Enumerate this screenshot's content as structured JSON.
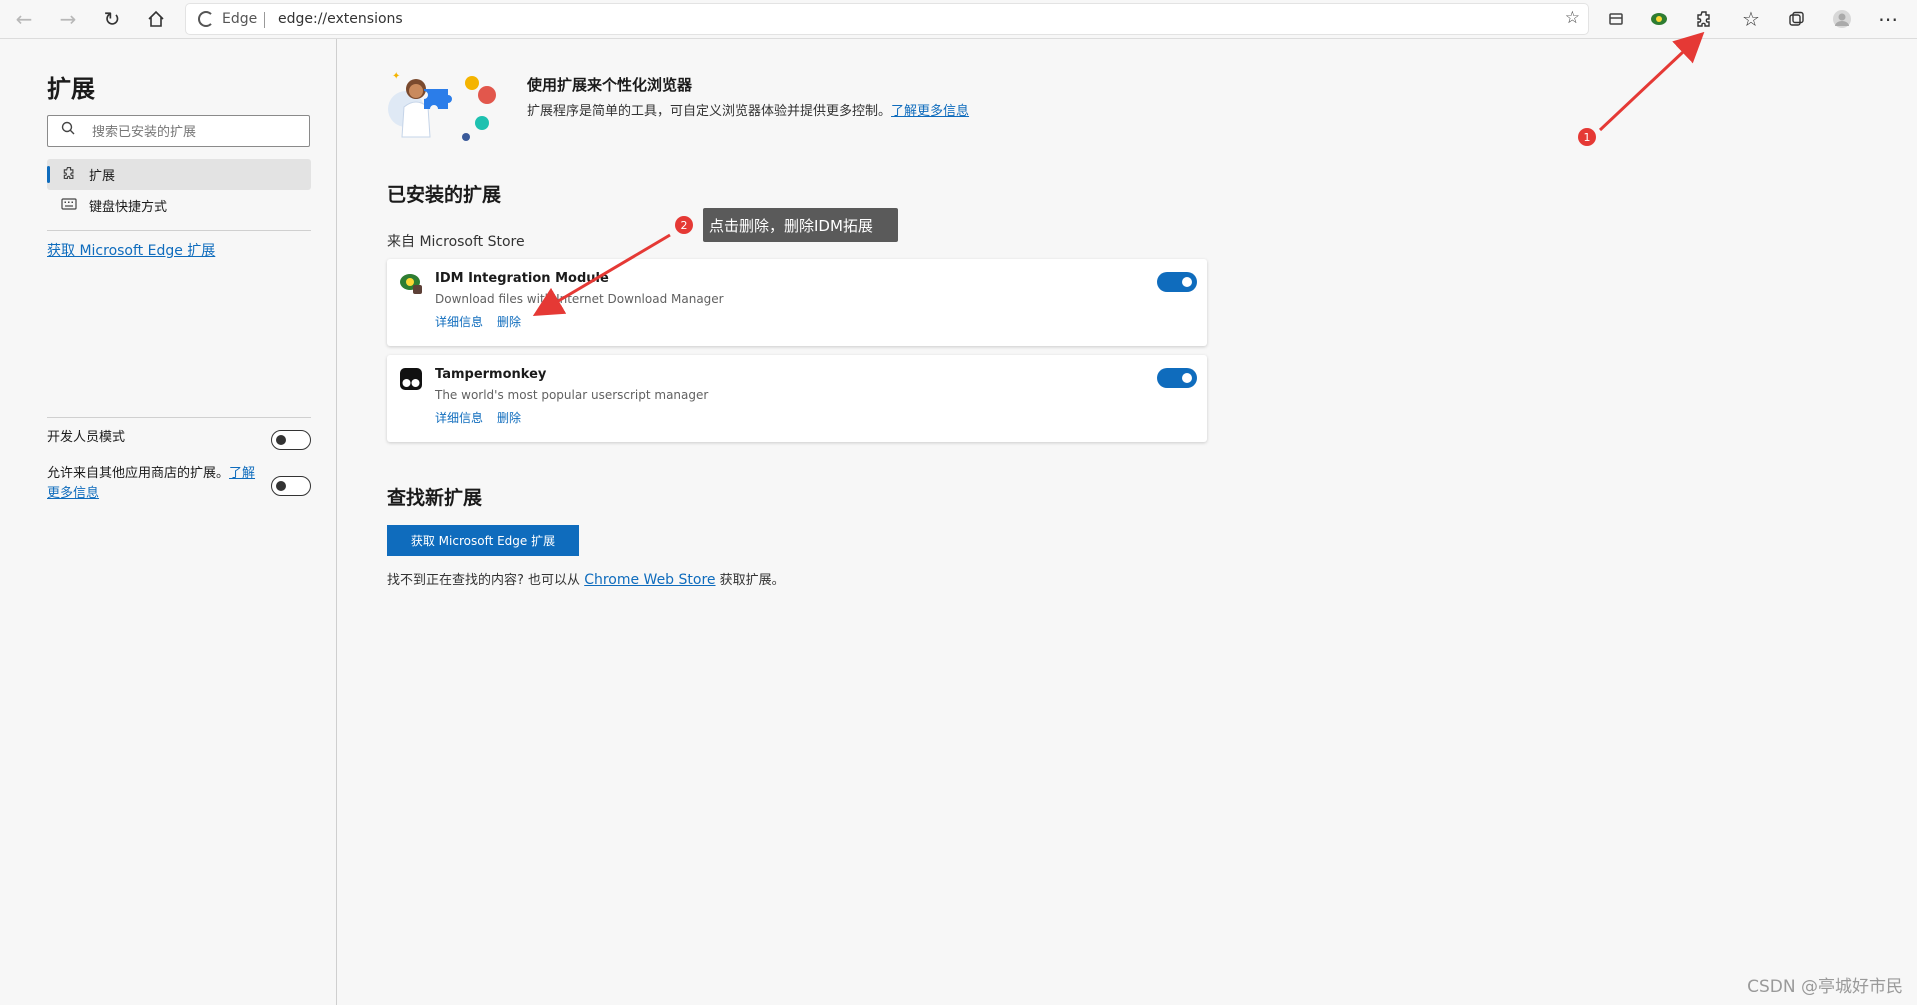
{
  "browser": {
    "site_label": "Edge",
    "url": "edge://extensions"
  },
  "sidebar": {
    "title": "扩展",
    "search_placeholder": "搜索已安装的扩展",
    "nav_items": [
      {
        "label": "扩展",
        "icon": "puzzle-icon",
        "active": true
      },
      {
        "label": "键盘快捷方式",
        "icon": "keyboard-icon",
        "active": false
      }
    ],
    "get_extensions_link": "获取 Microsoft Edge 扩展",
    "developer_mode_label": "开发人员模式",
    "developer_mode_on": false,
    "allow_other_stores_label": "允许来自其他应用商店的扩展。",
    "allow_other_stores_link": "了解更多信息",
    "allow_other_stores_on": false
  },
  "hero": {
    "title": "使用扩展来个性化浏览器",
    "desc": "扩展程序是简单的工具，可自定义浏览器体验并提供更多控制。",
    "learn_more": "了解更多信息"
  },
  "installed": {
    "title": "已安装的扩展",
    "source": "来自 Microsoft Store",
    "extensions": [
      {
        "name": "IDM Integration Module",
        "desc": "Download files with Internet Download Manager",
        "details": "详细信息",
        "remove": "删除",
        "enabled": true,
        "icon": "idm-icon"
      },
      {
        "name": "Tampermonkey",
        "desc": "The world's most popular userscript manager",
        "details": "详细信息",
        "remove": "删除",
        "enabled": true,
        "icon": "tampermonkey-icon"
      }
    ]
  },
  "find": {
    "title": "查找新扩展",
    "button": "获取 Microsoft Edge 扩展",
    "text_before": "找不到正在查找的内容? 也可以从",
    "link": "Chrome Web Store",
    "text_after": "获取扩展。"
  },
  "annotations": {
    "badge1": "1",
    "badge2": "2",
    "callout": "点击删除，删除IDM拓展",
    "arrow_color": "#e53935"
  },
  "watermark": "CSDN @亭城好市民",
  "colors": {
    "accent": "#0f6cbd"
  }
}
